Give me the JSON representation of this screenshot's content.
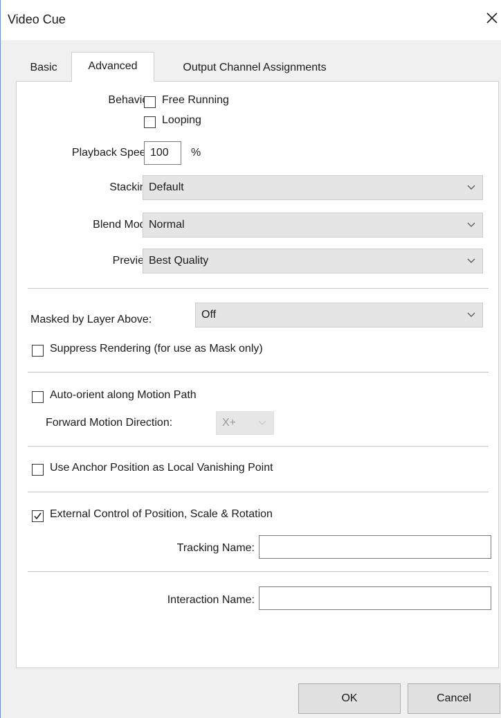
{
  "window": {
    "title": "Video Cue"
  },
  "tabs": [
    {
      "label": "Basic"
    },
    {
      "label": "Advanced",
      "active": true
    },
    {
      "label": "Output Channel Assignments"
    }
  ],
  "behavior": {
    "label": "Behavior:",
    "options": [
      {
        "label": "Free Running",
        "checked": false
      },
      {
        "label": "Looping",
        "checked": false
      }
    ]
  },
  "playback_speed": {
    "label": "Playback Speed:",
    "value": "100",
    "unit": "%"
  },
  "stacking": {
    "label": "Stacking:",
    "value": "Default"
  },
  "blend_mode": {
    "label": "Blend Mode:",
    "value": "Normal"
  },
  "preview": {
    "label": "Preview:",
    "value": "Best Quality"
  },
  "masked": {
    "label": "Masked by Layer Above:",
    "value": "Off"
  },
  "suppress": {
    "label": "Suppress Rendering (for use as Mask only)",
    "checked": false
  },
  "auto_orient": {
    "label": "Auto-orient along Motion Path",
    "checked": false
  },
  "forward_motion": {
    "label": "Forward Motion Direction:",
    "value": "X+",
    "disabled": true
  },
  "anchor": {
    "label": "Use Anchor Position as Local Vanishing Point",
    "checked": false
  },
  "external": {
    "label": "External Control of Position, Scale & Rotation",
    "checked": true
  },
  "tracking": {
    "label": "Tracking Name:",
    "value": ""
  },
  "interaction": {
    "label": "Interaction Name:",
    "value": ""
  },
  "buttons": {
    "ok": "OK",
    "cancel": "Cancel"
  },
  "colors": {
    "panel": "#ffffff",
    "window": "#f0f0f0",
    "combo": "#e5e5e5",
    "border": "#6f8fcf"
  }
}
